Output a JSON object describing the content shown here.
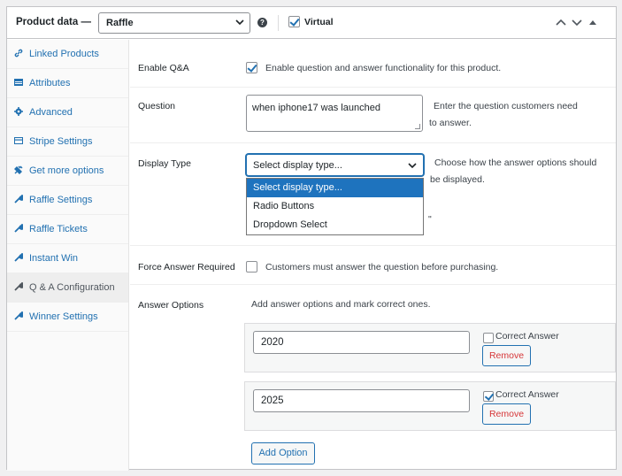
{
  "header": {
    "title": "Product data —",
    "product_type": "Raffle",
    "help_icon": "question-circle-icon",
    "virtual_label": "Virtual",
    "virtual_checked": true
  },
  "sidebar": {
    "items": [
      {
        "label": "Linked Products",
        "icon": "link-icon"
      },
      {
        "label": "Attributes",
        "icon": "table-icon"
      },
      {
        "label": "Advanced",
        "icon": "gear-icon"
      },
      {
        "label": "Stripe Settings",
        "icon": "card-icon"
      },
      {
        "label": "Get more options",
        "icon": "plugin-icon"
      },
      {
        "label": "Raffle Settings",
        "icon": "wrench-icon"
      },
      {
        "label": "Raffle Tickets",
        "icon": "wrench-icon"
      },
      {
        "label": "Instant Win",
        "icon": "wrench-icon"
      },
      {
        "label": "Q & A Configuration",
        "icon": "wrench-icon"
      },
      {
        "label": "Winner Settings",
        "icon": "wrench-icon"
      }
    ],
    "active": "Q & A Configuration"
  },
  "form": {
    "enable_qa": {
      "label": "Enable Q&A",
      "checked": true,
      "description": "Enable question and answer functionality for this product."
    },
    "question": {
      "label": "Question",
      "value": "when iphone17 was launched",
      "description_line1": "Enter the question customers need",
      "description_line2": "to answer."
    },
    "display_type": {
      "label": "Display Type",
      "value": "Select display type...",
      "description_line1": "Choose how the answer options should",
      "description_line2": "be displayed.",
      "options": [
        "Select display type...",
        "Radio Buttons",
        "Dropdown Select"
      ]
    },
    "force_answer": {
      "label": "Force Answer Required",
      "checked": false,
      "description": "Customers must answer the question before purchasing."
    },
    "answer_options": {
      "label": "Answer Options",
      "description": "Add answer options and mark correct ones.",
      "items": [
        {
          "value": "2020",
          "correct": false,
          "correct_label": "Correct Answer",
          "remove_label": "Remove"
        },
        {
          "value": "2025",
          "correct": true,
          "correct_label": "Correct Answer",
          "remove_label": "Remove"
        }
      ],
      "add_label": "Add Option"
    }
  },
  "colors": {
    "accent": "#2271b1",
    "selected_option": "#1e73be",
    "remove": "#d63638"
  }
}
